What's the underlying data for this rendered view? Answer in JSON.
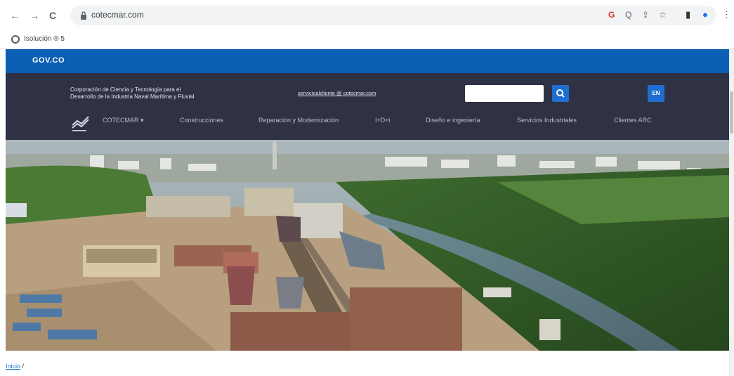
{
  "browser": {
    "back_icon": "←",
    "forward_icon": "→",
    "reload_icon": "C",
    "url": "cotecmar.com",
    "icons": {
      "google": "G",
      "zoom": "Q",
      "share": "⇪",
      "star": "☆",
      "sidepanel": "▮",
      "profile": "●",
      "menu": "⋮"
    }
  },
  "bookmarks": [
    {
      "label": "Isolución ® 5"
    }
  ],
  "gov_bar": {
    "logo": "GOV.CO",
    "color": "#0b5fb5"
  },
  "header": {
    "org_name": "Corporación de Ciencia y Tecnología para el\nDesarrollo de la Industria Naval Marítima y Fluvial",
    "email": "servicioalcliente @ cotecmar.com",
    "search_placeholder": "",
    "lang_label": "EN",
    "bg_color": "#2f3245",
    "accent_color": "#1e6fd0"
  },
  "nav": {
    "items": [
      {
        "label": "COTECMAR ▾"
      },
      {
        "label": "Construcciones"
      },
      {
        "label": "Reparación y Modernización"
      },
      {
        "label": "I+D+i"
      },
      {
        "label": "Diseño e ingeniería"
      },
      {
        "label": "Servicios Industriales"
      },
      {
        "label": "Clientes ARC"
      }
    ]
  },
  "hero": {
    "image": "aerial-shipyard"
  },
  "breadcrumb": {
    "home": "Inicio",
    "separator": "/"
  }
}
